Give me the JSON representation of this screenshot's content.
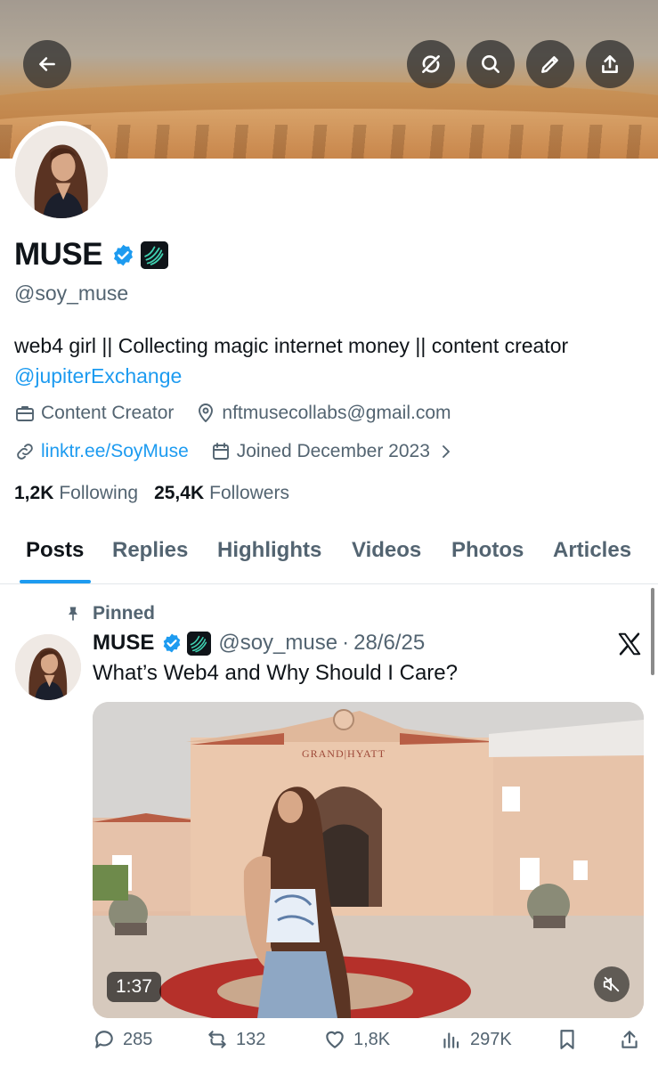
{
  "header": {
    "back_icon": "arrow-left-icon",
    "actions": [
      "no-sync-icon",
      "search-icon",
      "edit-icon",
      "share-icon"
    ]
  },
  "profile": {
    "name": "MUSE",
    "handle": "@soy_muse",
    "bio": "web4 girl || Collecting magic internet money || content creator",
    "bio_mention": "@jupiterExchange",
    "category": "Content Creator",
    "email": "nftmusecollabs@gmail.com",
    "link": "linktr.ee/SoyMuse",
    "joined": "Joined December 2023",
    "following_count": "1,2K",
    "following_label": "Following",
    "followers_count": "25,4K",
    "followers_label": "Followers"
  },
  "tabs": [
    "Posts",
    "Replies",
    "Highlights",
    "Videos",
    "Photos",
    "Articles"
  ],
  "pinned_tweet": {
    "pinned_label": "Pinned",
    "name": "MUSE",
    "handle": "@soy_muse",
    "separator": "·",
    "date": "28/6/25",
    "text": "What’s Web4 and Why Should I Care?",
    "media_sign": "GRAND|HYATT",
    "video_duration": "1:37",
    "replies": "285",
    "retweets": "132",
    "likes": "1,8K",
    "views": "297K"
  },
  "colors": {
    "accent": "#1d9bf0",
    "text_primary": "#0f1419",
    "text_secondary": "#536471"
  }
}
